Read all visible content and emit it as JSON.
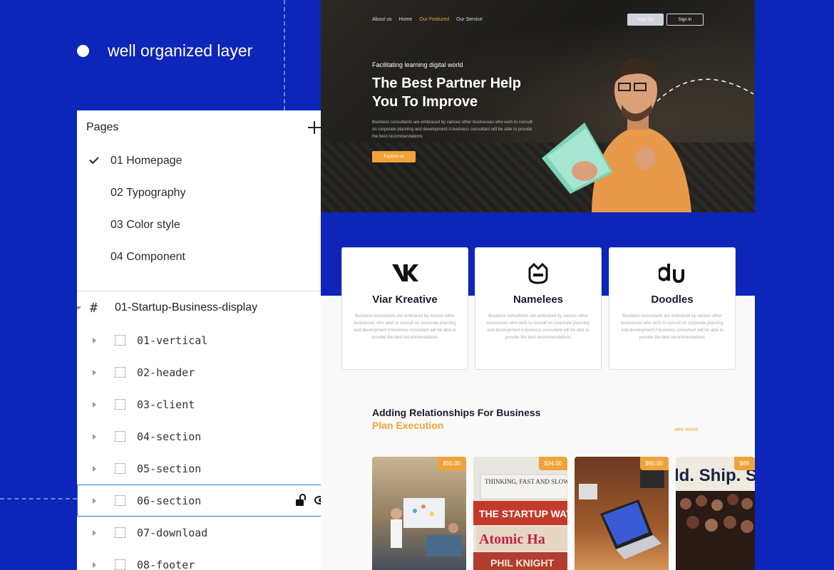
{
  "feature_caption": "well organized layer",
  "panel": {
    "title": "Pages",
    "pages": [
      {
        "label": "01 Homepage",
        "active": true
      },
      {
        "label": "02 Typography",
        "active": false
      },
      {
        "label": "03 Color style",
        "active": false
      },
      {
        "label": "04 Component",
        "active": false
      }
    ],
    "frame_name": "01-Startup-Business-display",
    "layers": [
      "01-vertical",
      "02-header",
      "03-client",
      "04-section",
      "05-section",
      "06-section",
      "07-download",
      "08-footer"
    ],
    "selected_layer": "06-section"
  },
  "site": {
    "nav": [
      "About us",
      "Home",
      "Our Featured",
      "Our Service"
    ],
    "nav_active": "Our Featured",
    "signup": "Sign Up",
    "signin": "Sign In",
    "kicker": "Facilitating learning digital world",
    "title": "The Best Partner Help You To Improve",
    "description": "Business consultants are embraced by various other businesses who wish to consult on corporate planning and development A business consultant will be able to provide the best recommendations",
    "explore": "Explore us",
    "cards": [
      {
        "title": "Viar Kreative",
        "logo": "vk-logo",
        "desc": "Business consultants are embraced by various other businesses who wish to consult on corporate planning and development A business consultant will be able to provide the best recommendations"
      },
      {
        "title": "Namelees",
        "logo": "crown-face-logo",
        "desc": "Business consultants are embraced by various other businesses who wish to consult on corporate planning and development A business consultant will be able to provide the best recommendations"
      },
      {
        "title": "Doodles",
        "logo": "du-logo",
        "desc": "Business consultants are embraced by various other businesses who wish to consult on corporate planning and development A business consultant will be able to provide the best recommendations"
      }
    ],
    "section_title": "Adding Relationships For Business",
    "section_sub": "Plan Execution",
    "see_more": "see more",
    "products": [
      {
        "price": "$50.00",
        "image": "office-meeting"
      },
      {
        "price": "$34.00",
        "image": "book-stack",
        "books": [
          "THINKING, FAST AND SLOW",
          "THE STARTUP WAY",
          "Atomic Ha",
          "PHIL KNIGHT"
        ]
      },
      {
        "price": "$60.00",
        "image": "laptop-desk"
      },
      {
        "price": "$89",
        "image": "crowd-banner",
        "banner": "ld. Ship. S"
      }
    ],
    "colors": {
      "accent": "#f0a33a",
      "brand_blue": "#0d25b8",
      "selection": "#2f6fd8"
    }
  }
}
